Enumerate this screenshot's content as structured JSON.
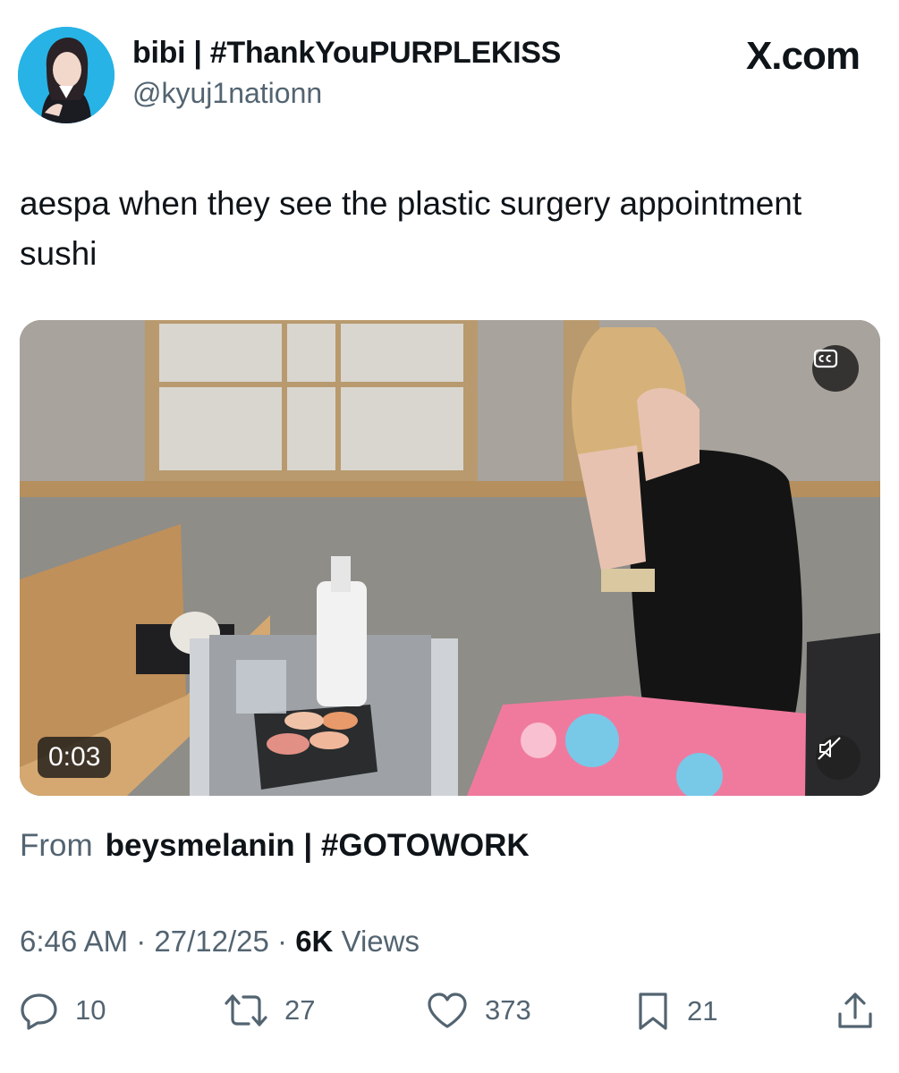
{
  "post": {
    "display_name": "bibi | #ThankYouPURPLEKISS",
    "handle": "@kyuj1nationn",
    "brand": "X.com",
    "text": "aespa when they see the plastic surgery appointment sushi"
  },
  "media": {
    "duration": "0:03",
    "cc_icon": "closed-captions-icon",
    "mute_icon": "muted-speaker-icon"
  },
  "attribution": {
    "from_label": "From",
    "source": "beysmelanin | #GOTOWORK"
  },
  "meta": {
    "time": "6:46 AM",
    "sep1": " · ",
    "date": "27/12/25",
    "sep2": " · ",
    "views_count": "6K",
    "views_label": " Views"
  },
  "actions": {
    "replies": "10",
    "reposts": "27",
    "likes": "373",
    "bookmarks": "21"
  },
  "colors": {
    "text": "#0f1419",
    "secondary": "#536471",
    "avatar_bg": "#27b3e6"
  }
}
